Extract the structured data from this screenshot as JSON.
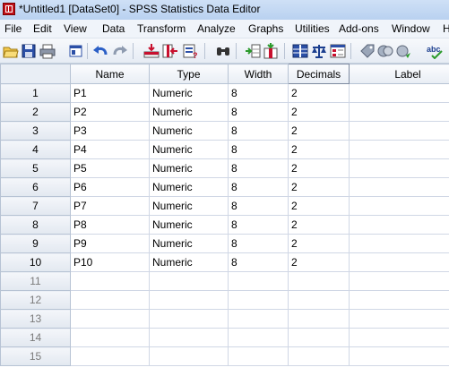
{
  "window": {
    "title": "*Untitled1 [DataSet0] - SPSS Statistics Data Editor"
  },
  "menu": [
    "File",
    "Edit",
    "View",
    "Data",
    "Transform",
    "Analyze",
    "Graphs",
    "Utilities",
    "Add-ons",
    "Window",
    "H"
  ],
  "toolbar": [
    "open-icon",
    "save-icon",
    "print-icon",
    "dialog-recall-icon",
    "undo-icon",
    "redo-icon",
    "goto-case-icon",
    "goto-variable-icon",
    "variables-icon",
    "find-icon",
    "insert-cases-icon",
    "insert-variable-icon",
    "split-file-icon",
    "weight-cases-icon",
    "select-cases-icon",
    "value-labels-icon",
    "use-sets-icon",
    "show-all-icon",
    "spelling-icon"
  ],
  "columns": [
    "Name",
    "Type",
    "Width",
    "Decimals",
    "Label"
  ],
  "rows": [
    {
      "num": "1",
      "name": "P1",
      "type": "Numeric",
      "width": "8",
      "decimals": "2",
      "label": ""
    },
    {
      "num": "2",
      "name": "P2",
      "type": "Numeric",
      "width": "8",
      "decimals": "2",
      "label": ""
    },
    {
      "num": "3",
      "name": "P3",
      "type": "Numeric",
      "width": "8",
      "decimals": "2",
      "label": ""
    },
    {
      "num": "4",
      "name": "P4",
      "type": "Numeric",
      "width": "8",
      "decimals": "2",
      "label": ""
    },
    {
      "num": "5",
      "name": "P5",
      "type": "Numeric",
      "width": "8",
      "decimals": "2",
      "label": ""
    },
    {
      "num": "6",
      "name": "P6",
      "type": "Numeric",
      "width": "8",
      "decimals": "2",
      "label": ""
    },
    {
      "num": "7",
      "name": "P7",
      "type": "Numeric",
      "width": "8",
      "decimals": "2",
      "label": ""
    },
    {
      "num": "8",
      "name": "P8",
      "type": "Numeric",
      "width": "8",
      "decimals": "2",
      "label": ""
    },
    {
      "num": "9",
      "name": "P9",
      "type": "Numeric",
      "width": "8",
      "decimals": "2",
      "label": ""
    },
    {
      "num": "10",
      "name": "P10",
      "type": "Numeric",
      "width": "8",
      "decimals": "2",
      "label": ""
    },
    {
      "num": "11",
      "name": "",
      "type": "",
      "width": "",
      "decimals": "",
      "label": ""
    },
    {
      "num": "12",
      "name": "",
      "type": "",
      "width": "",
      "decimals": "",
      "label": ""
    },
    {
      "num": "13",
      "name": "",
      "type": "",
      "width": "",
      "decimals": "",
      "label": ""
    },
    {
      "num": "14",
      "name": "",
      "type": "",
      "width": "",
      "decimals": "",
      "label": ""
    },
    {
      "num": "15",
      "name": "",
      "type": "",
      "width": "",
      "decimals": "",
      "label": ""
    }
  ]
}
